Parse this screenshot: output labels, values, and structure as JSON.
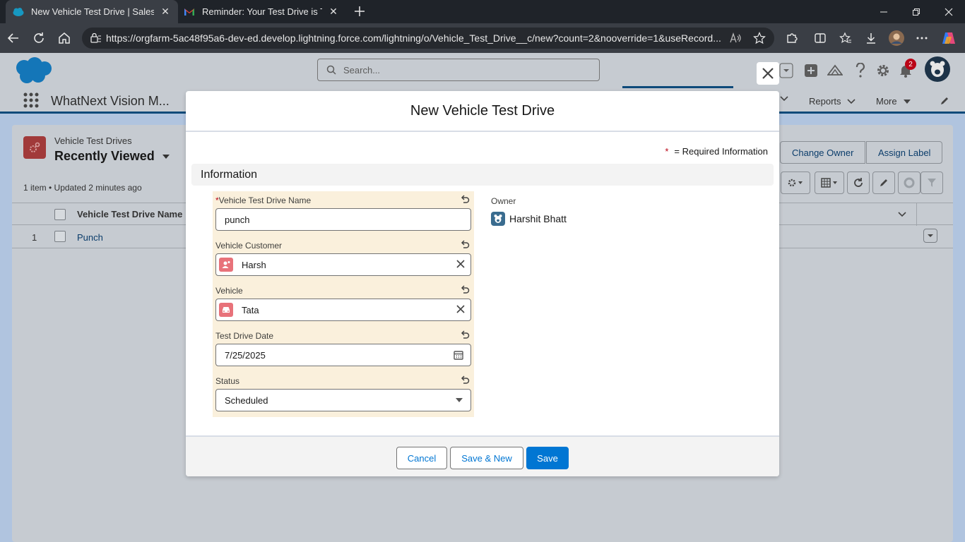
{
  "browser": {
    "tabs": [
      {
        "label": "New Vehicle Test Drive | Salesforce",
        "icon": "salesforce-cloud-icon",
        "active": true
      },
      {
        "label": "Reminder: Your Test Drive is Tomorrow",
        "icon": "gmail-icon",
        "active": false
      }
    ],
    "url": "https://orgfarm-5ac48f95a6-dev-ed.develop.lightning.force.com/lightning/o/Vehicle_Test_Drive__c/new?count=2&nooverride=1&useRecord..."
  },
  "sf_header": {
    "search_placeholder": "Search...",
    "notification_count": "2"
  },
  "nav": {
    "app_name": "WhatNext Vision M...",
    "items": [
      "Reports",
      "More"
    ]
  },
  "list": {
    "object_label": "Vehicle Test Drives",
    "view_name": "Recently Viewed",
    "meta": "1 item • Updated 2 minutes ago",
    "buttons": {
      "change_owner": "Change Owner",
      "assign_label": "Assign Label"
    },
    "column_header": "Vehicle Test Drive Name",
    "rows": [
      {
        "num": "1",
        "name": "Punch"
      }
    ]
  },
  "modal": {
    "title": "New Vehicle Test Drive",
    "required_star": "*",
    "required_note": "= Required Information",
    "section": "Information",
    "fields": {
      "name": {
        "label": "Vehicle Test Drive Name",
        "value": "punch",
        "required": true
      },
      "customer": {
        "label": "Vehicle Customer",
        "value": "Harsh"
      },
      "vehicle": {
        "label": "Vehicle",
        "value": "Tata"
      },
      "date": {
        "label": "Test Drive Date",
        "value": "7/25/2025"
      },
      "status": {
        "label": "Status",
        "value": "Scheduled"
      }
    },
    "owner": {
      "label": "Owner",
      "value": "Harshit Bhatt"
    },
    "footer": {
      "cancel": "Cancel",
      "save_new": "Save & New",
      "save": "Save"
    }
  },
  "colors": {
    "brand": "#0176d3",
    "required": "#ba0517",
    "highlight": "#faf0dc"
  }
}
